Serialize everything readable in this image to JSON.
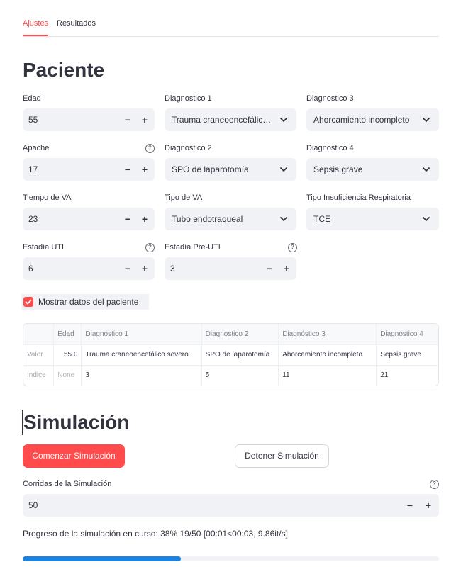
{
  "tabs": {
    "ajustes": "Ajustes",
    "resultados": "Resultados"
  },
  "paciente": {
    "heading": "Paciente",
    "edad": {
      "label": "Edad",
      "value": "55"
    },
    "apache": {
      "label": "Apache",
      "value": "17"
    },
    "tiempo_va": {
      "label": "Tiempo de VA",
      "value": "23"
    },
    "estadia_uti": {
      "label": "Estadía UTI",
      "value": "6"
    },
    "diagnostico1": {
      "label": "Diagnostico 1",
      "value": "Trauma craneoencefálico severo"
    },
    "diagnostico2": {
      "label": "Diagnostico 2",
      "value": "SPO de laparotomía"
    },
    "tipo_va": {
      "label": "Tipo de VA",
      "value": "Tubo endotraqueal"
    },
    "estadia_pre_uti": {
      "label": "Estadía Pre-UTI",
      "value": "3"
    },
    "diagnostico3": {
      "label": "Diagnostico 3",
      "value": "Ahorcamiento incompleto"
    },
    "diagnostico4": {
      "label": "Diagnostico 4",
      "value": "Sepsis grave"
    },
    "tipo_ir": {
      "label": "Tipo Insuficiencia Respiratoria",
      "value": "TCE"
    },
    "checkbox_label": "Mostrar datos del paciente",
    "stepper": {
      "minus": "−",
      "plus": "+"
    },
    "help": "?"
  },
  "table": {
    "headers": [
      "",
      "Edad",
      "Diagnóstico 1",
      "Diagnostico 2",
      "Diagnóstico 3",
      "Diagnóstico 4"
    ],
    "rows": [
      [
        "Valor",
        "55.0",
        "Trauma craneoencefálico severo",
        "SPO de laparotomía",
        "Ahorcamiento incompleto",
        "Sepsis grave"
      ],
      [
        "Índice",
        "None",
        "3",
        "5",
        "11",
        "21"
      ]
    ]
  },
  "simulacion": {
    "heading": "Simulación",
    "start_button": "Comenzar Simulación",
    "stop_button": "Detener Simulación",
    "corridas_label": "Corridas de la Simulación",
    "corridas_value": "50",
    "progress_text": "Progreso de la simulación en curso: 38% 19/50 [00:01<00:03, 9.86it/s]",
    "progress_fraction": 0.38
  },
  "colors": {
    "accent": "#ff4b4b",
    "progress": "#1c83e1",
    "input_bg": "#f0f2f6"
  }
}
